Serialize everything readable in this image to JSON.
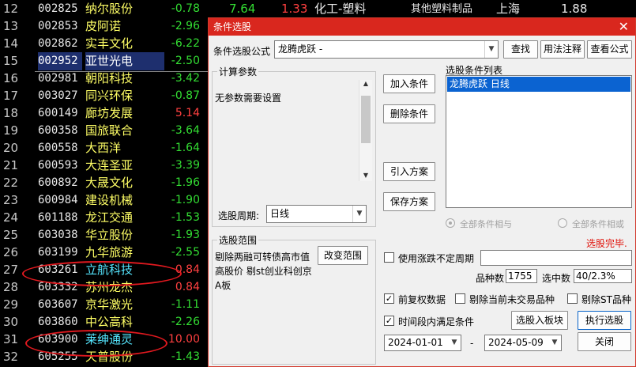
{
  "stocks": [
    {
      "num": "12",
      "code": "002825",
      "name": "纳尔股份",
      "chg": "-0.78"
    },
    {
      "num": "13",
      "code": "002853",
      "name": "皮阿诺",
      "chg": "-2.96"
    },
    {
      "num": "14",
      "code": "002862",
      "name": "实丰文化",
      "chg": "-6.22"
    },
    {
      "num": "15",
      "code": "002952",
      "name": "亚世光电",
      "chg": "-2.50"
    },
    {
      "num": "16",
      "code": "002981",
      "name": "朝阳科技",
      "chg": "-3.42"
    },
    {
      "num": "17",
      "code": "003027",
      "name": "同兴环保",
      "chg": "-0.87"
    },
    {
      "num": "18",
      "code": "600149",
      "name": "廊坊发展",
      "chg": "5.14"
    },
    {
      "num": "19",
      "code": "600358",
      "name": "国旅联合",
      "chg": "-3.64"
    },
    {
      "num": "20",
      "code": "600558",
      "name": "大西洋",
      "chg": "-1.64"
    },
    {
      "num": "21",
      "code": "600593",
      "name": "大连圣亚",
      "chg": "-3.39"
    },
    {
      "num": "22",
      "code": "600892",
      "name": "大晟文化",
      "chg": "-1.96"
    },
    {
      "num": "23",
      "code": "600984",
      "name": "建设机械",
      "chg": "-1.90"
    },
    {
      "num": "24",
      "code": "601188",
      "name": "龙江交通",
      "chg": "-1.53"
    },
    {
      "num": "25",
      "code": "603038",
      "name": "华立股份",
      "chg": "-1.93"
    },
    {
      "num": "26",
      "code": "603199",
      "name": "九华旅游",
      "chg": "-2.55"
    },
    {
      "num": "27",
      "code": "603261",
      "name": "立航科技",
      "chg": "0.84"
    },
    {
      "num": "28",
      "code": "603332",
      "name": "苏州龙杰",
      "chg": "0.84"
    },
    {
      "num": "29",
      "code": "603607",
      "name": "京华激光",
      "chg": "-1.11"
    },
    {
      "num": "30",
      "code": "603860",
      "name": "中公高科",
      "chg": "-2.26"
    },
    {
      "num": "31",
      "code": "603900",
      "name": "莱绅通灵",
      "chg": "10.00"
    },
    {
      "num": "32",
      "code": "605255",
      "name": "天普股份",
      "chg": "-1.43"
    }
  ],
  "top_strip": {
    "v1": "7.64",
    "v2": "1.33",
    "industry": "化工-塑料",
    "sub": "其他塑料制品",
    "region": "上海",
    "v3": "1.88"
  },
  "colors": {
    "up": "#ff4040",
    "down": "#33dd33",
    "highlight_cyan": "#55e6ff",
    "annotation": "#e2191f",
    "title_bar": "#d9271e"
  },
  "dialog": {
    "title": "条件选股",
    "close_label": "✕",
    "formula_label": "条件选股公式",
    "formula_value": "龙腾虎跃  -",
    "find_btn": "查找",
    "usage_btn": "用法注释",
    "view_btn": "查看公式",
    "calc_group": "计算参数",
    "calc_text": "无参数需要设置",
    "period_label": "选股周期:",
    "period_value": "日线",
    "add_btn": "加入条件",
    "delete_btn": "删除条件",
    "import_btn": "引入方案",
    "save_btn": "保存方案",
    "cond_list_label": "选股条件列表",
    "cond_items": [
      "龙腾虎跃  日线"
    ],
    "radio_and": "全部条件相与",
    "radio_or": "全部条件相或",
    "status": "选股完毕.",
    "scope_group": "选股范围",
    "scope_text": "剔除两融可转债高市值高股价 剔st创业科创京A板",
    "change_scope_btn": "改变范围",
    "use_uncertain_label": "使用涨跌不定周期",
    "count_label": "品种数",
    "count_value": "1755",
    "selected_label": "选中数",
    "selected_value": "40/2.3%",
    "fq_label": "前复权数据",
    "remove_untraded_label": "剔除当前未交易品种",
    "remove_st_label": "剔除ST品种",
    "time_range_label": "时间段内满足条件",
    "to_block_btn": "选股入板块",
    "exec_btn": "执行选股",
    "start_date": "2024-01-01",
    "dash": "-",
    "end_date": "2024-05-09",
    "close_btn": "关闭",
    "check_mark": "✓"
  }
}
